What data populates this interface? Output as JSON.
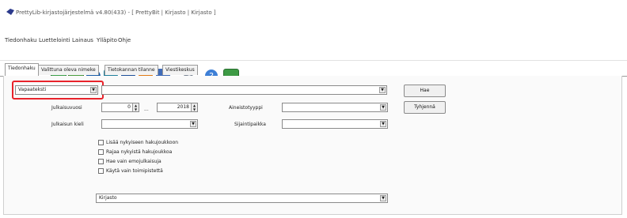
{
  "window": {
    "title": "PrettyLib-kirjastojärjestelmä v4.80(433) - [ PrettyBit | Kirjasto | Kirjasto ]"
  },
  "menu": [
    "Tiedonhaku",
    "Luettelointi",
    "Lainaus",
    "Ylläpito",
    "Ohje"
  ],
  "toolbar": {
    "dropdown_glyph": "▾"
  },
  "tabs": [
    "Tiedonhaku",
    "Valittuna oleva nimeke",
    "Tietokannan tilanne",
    "Viestikeskus"
  ],
  "search": {
    "field_type": "Vapaateksti",
    "query": "",
    "year_label": "Julkaisuvuosi",
    "year_from": "0",
    "year_sep": "...",
    "year_to": "2018",
    "language_label": "Julkaisun kieli",
    "language_value": "",
    "material_label": "Aineistotyyppi",
    "material_value": "",
    "location_label": "Sijaintipaikka",
    "location_value": "",
    "options": [
      "Lisää nykyiseen hakujoukkoon",
      "Rajaa nykyistä hakujoukkoa",
      "Hae vain emojulkaisuja",
      "Käytä vain toimipistettä"
    ],
    "library": "Kirjasto"
  },
  "buttons": {
    "search": "Hae",
    "clear": "Tyhjennä"
  },
  "colors": {
    "highlight": "#e8232b"
  }
}
